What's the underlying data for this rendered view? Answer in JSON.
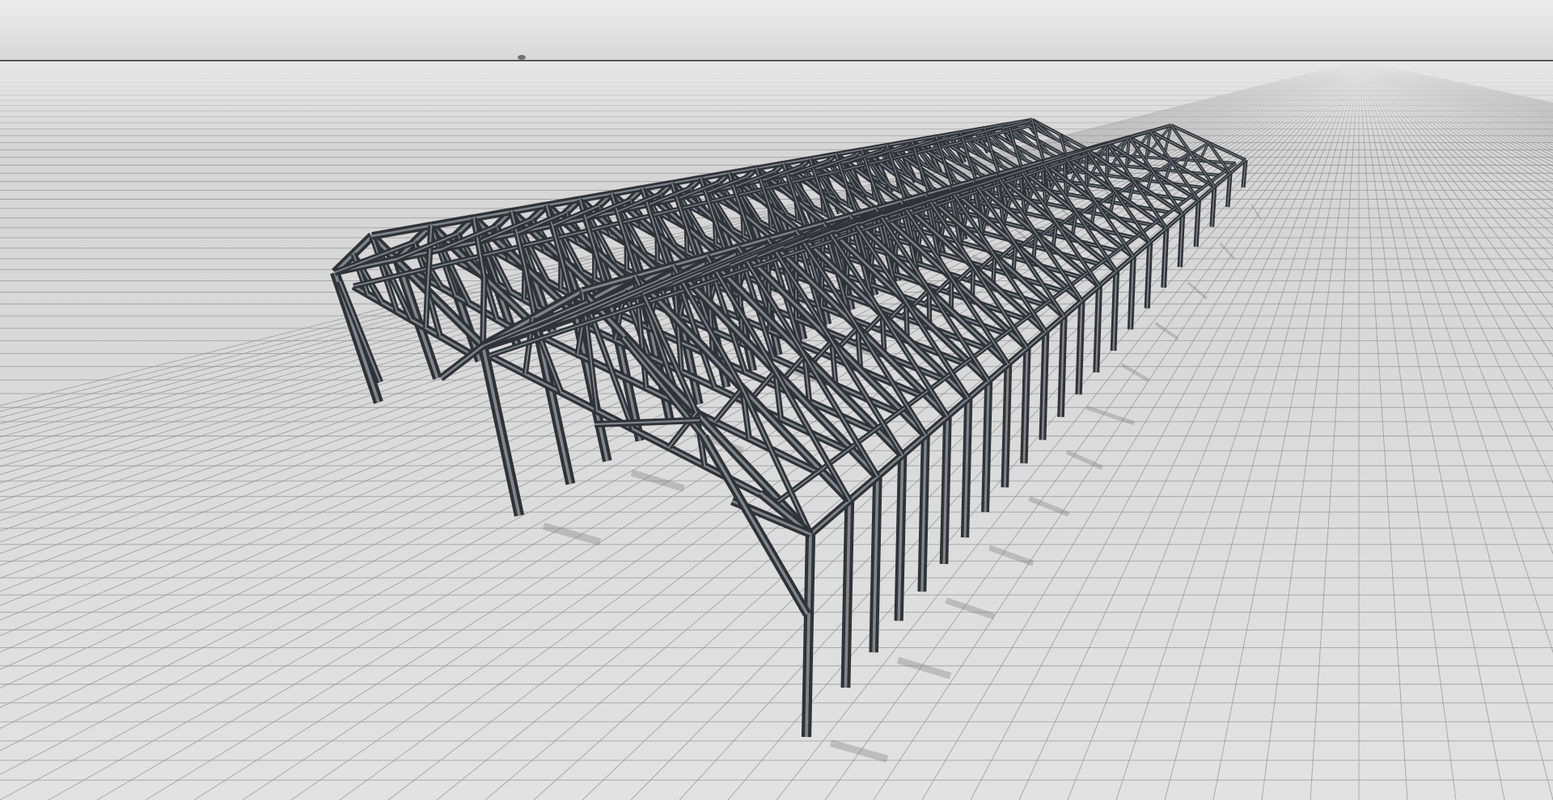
{
  "app": {
    "window_title": ""
  },
  "viewport": {
    "view_mode": "perspective",
    "ground_grid": true,
    "shadows": true,
    "colors": {
      "sky_top": "#ececec",
      "sky_bottom": "#d8d8d8",
      "horizon_line": "#2c2c2c",
      "ground_near": "#e2e2e2",
      "ground_far": "#d3d3d3",
      "grid_line": "#8f8f8f",
      "member_dark": "#2f3338",
      "member_light": "#8e939a",
      "shadow": "#7a7a7a"
    }
  },
  "model": {
    "type": "steel-frame-truss-structure",
    "bays": 2,
    "frames_per_bay": 23
  }
}
